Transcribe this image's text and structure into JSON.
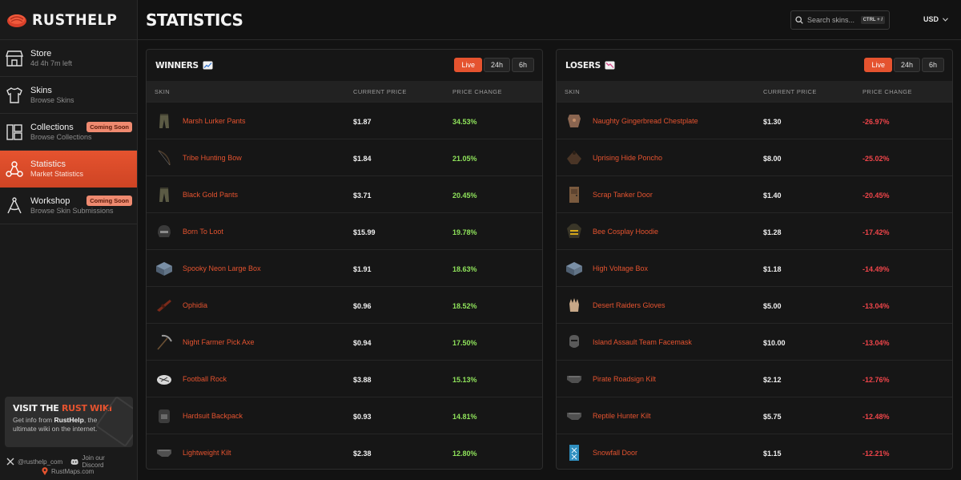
{
  "app": {
    "name": "RUSTHELP"
  },
  "colors": {
    "accent": "#e5532f",
    "positive": "#8fe35b",
    "negative": "#f0454a",
    "badge": "#ef8a70"
  },
  "sidebar": {
    "items": [
      {
        "title": "Store",
        "subtitle": "4d 4h 7m left",
        "icon": "store-icon",
        "badge": ""
      },
      {
        "title": "Skins",
        "subtitle": "Browse Skins",
        "icon": "shirt-icon",
        "badge": ""
      },
      {
        "title": "Collections",
        "subtitle": "Browse Collections",
        "icon": "collections-icon",
        "badge": "Coming Soon"
      },
      {
        "title": "Statistics",
        "subtitle": "Market Statistics",
        "icon": "network-icon",
        "badge": "",
        "active": true
      },
      {
        "title": "Workshop",
        "subtitle": "Browse Skin Submissions",
        "icon": "compass-icon",
        "badge": "Coming Soon"
      }
    ],
    "wiki": {
      "title_prefix": "VISIT THE ",
      "title_accent": "RUST WIKI",
      "desc_before": "Get info from ",
      "desc_brand": "RustHelp",
      "desc_after": ", the ultimate wiki on the internet."
    },
    "social": {
      "twitter": "@rusthelp_com",
      "discord": "Join our Discord",
      "maps": "RustMaps.com"
    }
  },
  "header": {
    "title": "STATISTICS",
    "search": {
      "placeholder": "Search skins...",
      "shortcut": "CTRL + /"
    },
    "currency": "USD"
  },
  "columns": {
    "skin": "SKIN",
    "price": "CURRENT PRICE",
    "change": "PRICE CHANGE"
  },
  "winners": {
    "title": "WINNERS",
    "timeframes": [
      "Live",
      "24h",
      "6h"
    ],
    "active_timeframe": "Live",
    "rows": [
      {
        "name": "Marsh Lurker Pants",
        "price": "$1.87",
        "change": "34.53%",
        "icon": "pants-icon"
      },
      {
        "name": "Tribe Hunting Bow",
        "price": "$1.84",
        "change": "21.05%",
        "icon": "bow-icon"
      },
      {
        "name": "Black Gold Pants",
        "price": "$3.71",
        "change": "20.45%",
        "icon": "pants-icon"
      },
      {
        "name": "Born To Loot",
        "price": "$15.99",
        "change": "19.78%",
        "icon": "helmet-icon"
      },
      {
        "name": "Spooky Neon Large Box",
        "price": "$1.91",
        "change": "18.63%",
        "icon": "box-icon"
      },
      {
        "name": "Ophidia",
        "price": "$0.96",
        "change": "18.52%",
        "icon": "rifle-icon"
      },
      {
        "name": "Night Farmer Pick Axe",
        "price": "$0.94",
        "change": "17.50%",
        "icon": "pickaxe-icon"
      },
      {
        "name": "Football Rock",
        "price": "$3.88",
        "change": "15.13%",
        "icon": "rock-icon"
      },
      {
        "name": "Hardsuit Backpack",
        "price": "$0.93",
        "change": "14.81%",
        "icon": "backpack-icon"
      },
      {
        "name": "Lightweight Kilt",
        "price": "$2.38",
        "change": "12.80%",
        "icon": "kilt-icon"
      }
    ]
  },
  "losers": {
    "title": "LOSERS",
    "timeframes": [
      "Live",
      "24h",
      "6h"
    ],
    "active_timeframe": "Live",
    "rows": [
      {
        "name": "Naughty Gingerbread Chestplate",
        "price": "$1.30",
        "change": "-26.97%",
        "icon": "chestplate-icon"
      },
      {
        "name": "Uprising Hide Poncho",
        "price": "$8.00",
        "change": "-25.02%",
        "icon": "poncho-icon"
      },
      {
        "name": "Scrap Tanker Door",
        "price": "$1.40",
        "change": "-20.45%",
        "icon": "door-icon"
      },
      {
        "name": "Bee Cosplay Hoodie",
        "price": "$1.28",
        "change": "-17.42%",
        "icon": "hoodie-icon"
      },
      {
        "name": "High Voltage Box",
        "price": "$1.18",
        "change": "-14.49%",
        "icon": "box-icon"
      },
      {
        "name": "Desert Raiders Gloves",
        "price": "$5.00",
        "change": "-13.04%",
        "icon": "gloves-icon"
      },
      {
        "name": "Island Assault Team Facemask",
        "price": "$10.00",
        "change": "-13.04%",
        "icon": "facemask-icon"
      },
      {
        "name": "Pirate Roadsign Kilt",
        "price": "$2.12",
        "change": "-12.76%",
        "icon": "kilt-icon"
      },
      {
        "name": "Reptile Hunter Kilt",
        "price": "$5.75",
        "change": "-12.48%",
        "icon": "kilt-icon"
      },
      {
        "name": "Snowfall Door",
        "price": "$1.15",
        "change": "-12.21%",
        "icon": "door-icon"
      }
    ]
  }
}
